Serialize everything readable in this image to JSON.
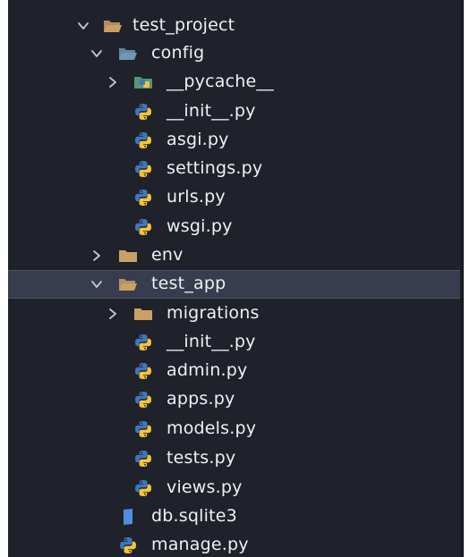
{
  "explorer": {
    "items": [
      {
        "label": "test_project",
        "kind": "folder",
        "expanded": true,
        "depth": 0
      },
      {
        "label": "config",
        "kind": "folder-config",
        "expanded": true,
        "depth": 1
      },
      {
        "label": "__pycache__",
        "kind": "folder-pycache",
        "expanded": false,
        "depth": 2
      },
      {
        "label": "__init__.py",
        "kind": "python",
        "depth": 2
      },
      {
        "label": "asgi.py",
        "kind": "python",
        "depth": 2
      },
      {
        "label": "settings.py",
        "kind": "python",
        "depth": 2
      },
      {
        "label": "urls.py",
        "kind": "python",
        "depth": 2
      },
      {
        "label": "wsgi.py",
        "kind": "python",
        "depth": 2
      },
      {
        "label": "env",
        "kind": "folder",
        "expanded": false,
        "depth": 1
      },
      {
        "label": "test_app",
        "kind": "folder",
        "expanded": true,
        "depth": 1,
        "selected": true
      },
      {
        "label": "migrations",
        "kind": "folder",
        "expanded": false,
        "depth": 2
      },
      {
        "label": "__init__.py",
        "kind": "python",
        "depth": 2
      },
      {
        "label": "admin.py",
        "kind": "python",
        "depth": 2
      },
      {
        "label": "apps.py",
        "kind": "python",
        "depth": 2
      },
      {
        "label": "models.py",
        "kind": "python",
        "depth": 2
      },
      {
        "label": "tests.py",
        "kind": "python",
        "depth": 2
      },
      {
        "label": "views.py",
        "kind": "python",
        "depth": 2
      },
      {
        "label": "db.sqlite3",
        "kind": "database",
        "depth": 1
      },
      {
        "label": "manage.py",
        "kind": "python",
        "depth": 1
      }
    ]
  },
  "colors": {
    "background": "#20222b",
    "selected_row": "#373d4e",
    "folder": "#c9a167",
    "folder_config": "#6e98b4",
    "pycache": "#4f9a76",
    "python_blue": "#3d77c0",
    "python_yellow": "#f3c53c",
    "database": "#4f8fe2",
    "chevron": "#c2c6cf"
  }
}
